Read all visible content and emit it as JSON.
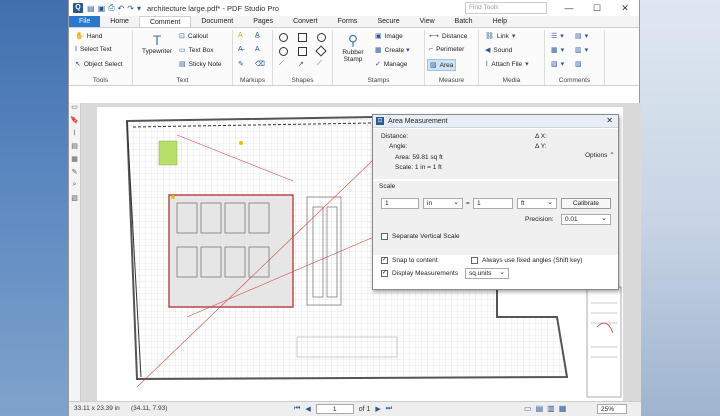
{
  "window": {
    "title": "architecture large.pdf* - PDF Studio Pro",
    "find_tools_placeholder": "Find Tools",
    "minimize": "—",
    "maximize": "☐",
    "close": "✕"
  },
  "tabs": [
    "File",
    "Home",
    "Comment",
    "Document",
    "Pages",
    "Convert",
    "Forms",
    "Secure",
    "View",
    "Batch",
    "Help"
  ],
  "active_tab": "Comment",
  "ribbon": {
    "tools": {
      "label": "Tools",
      "hand": "Hand",
      "select_text": "Select Text",
      "object_select": "Object Select"
    },
    "text": {
      "label": "Text",
      "typewriter": "Typewriter",
      "callout": "Callout",
      "text_box": "Text Box",
      "sticky_note": "Sticky Note"
    },
    "markups": {
      "label": "Markups"
    },
    "shapes": {
      "label": "Shapes"
    },
    "stamps": {
      "label": "Stamps",
      "rubber_stamp": "Rubber Stamp",
      "image": "Image",
      "create": "Create",
      "manage": "Manage"
    },
    "measure": {
      "label": "Measure",
      "distance": "Distance",
      "perimeter": "Perimeter",
      "area": "Area"
    },
    "media": {
      "label": "Media",
      "link": "Link",
      "sound": "Sound",
      "attach_file": "Attach File"
    },
    "comments": {
      "label": "Comments"
    }
  },
  "dialog": {
    "title": "Area Measurement",
    "distance_label": "Distance:",
    "angle_label": "Angle:",
    "dx": "Δ X:",
    "dy": "Δ Y:",
    "area": "Area: 59.81 sq ft",
    "scale_info": "Scale: 1 in = 1 ft",
    "options": "Options ⌃",
    "scale_label": "Scale",
    "scale_value_1": "1",
    "scale_unit_1": "in",
    "equals": "=",
    "scale_value_2": "1",
    "scale_unit_2": "ft",
    "calibrate": "Calibrate",
    "precision_label": "Precision:",
    "precision_value": "0.01",
    "separate_vertical": "Separate Vertical Scale",
    "snap": "Snap to content",
    "fixed_angles": "Always use fixed angles (Shift key)",
    "display_measurements": "Display Measurements",
    "display_units": "sq units"
  },
  "status": {
    "page_size": "33.11 x 23.39 in",
    "cursor": "(34.11, 7.93)",
    "page_value": "1",
    "page_of": "of 1",
    "zoom": "25%"
  },
  "colors": {
    "accent": "#2b78d1",
    "dialog_title": "#e8eef6",
    "plan_line": "#555555",
    "measure_line": "#d04545",
    "highlight": "#b7e06a"
  }
}
